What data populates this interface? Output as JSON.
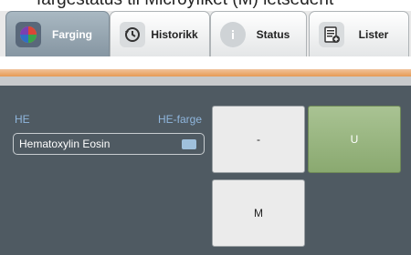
{
  "header_text": "fargestatus til Microyflket (M) letsedent",
  "tabs": [
    {
      "label": "Farging",
      "icon": "color-wheel-icon",
      "active": true
    },
    {
      "label": "Historikk",
      "icon": "history-icon",
      "active": false
    },
    {
      "label": "Status",
      "icon": "info-icon",
      "active": false
    },
    {
      "label": "Lister",
      "icon": "list-icon",
      "active": false
    }
  ],
  "stain": {
    "label": "HE",
    "type_label": "HE-farge",
    "value": "Hematoxylin Eosin"
  },
  "buttons": {
    "minus": "-",
    "u": "U",
    "m": "M"
  },
  "colors": {
    "accent": "#e69a55",
    "panel": "#4f5a62",
    "selected_green": "#8aa970",
    "label_blue": "#8fb6dd"
  }
}
